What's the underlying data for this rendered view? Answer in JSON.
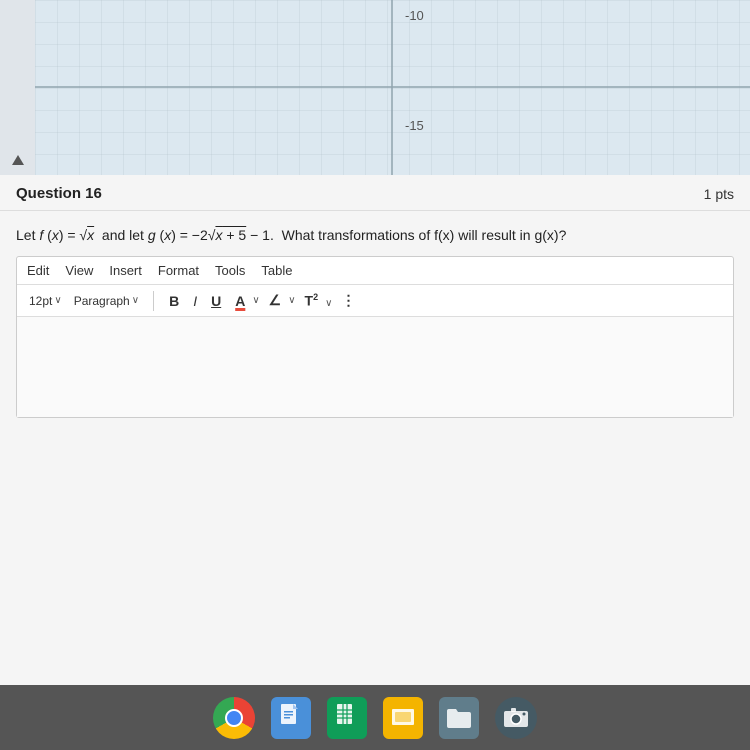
{
  "graph": {
    "label_minus10": "-10",
    "label_minus15": "-15"
  },
  "question": {
    "title": "Question 16",
    "points": "1 pts",
    "body_text": "Let f (x) = √x  and let g (x) = −2√x + 5 − 1.  What transformations of f(x) will result in g(x)?",
    "editor": {
      "menu_items": [
        "Edit",
        "View",
        "Insert",
        "Format",
        "Tools",
        "Table"
      ],
      "font_size": "12pt",
      "font_size_chevron": "∨",
      "style": "Paragraph",
      "style_chevron": "∨",
      "btn_bold": "B",
      "btn_italic": "I",
      "btn_underline": "U",
      "btn_font_color": "A",
      "btn_highlight": "∠",
      "btn_superscript": "T²",
      "btn_more": "⋮"
    }
  },
  "taskbar": {
    "icons": [
      {
        "name": "chrome",
        "label": "Chrome"
      },
      {
        "name": "docs",
        "label": "Google Docs"
      },
      {
        "name": "sheets",
        "label": "Google Sheets"
      },
      {
        "name": "slides",
        "label": "Google Slides"
      },
      {
        "name": "drive",
        "label": "Google Drive"
      },
      {
        "name": "camera",
        "label": "Camera"
      }
    ]
  }
}
